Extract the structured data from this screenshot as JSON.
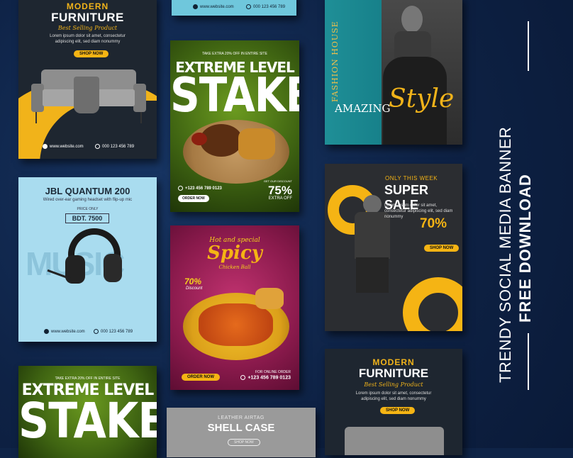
{
  "colors": {
    "accent": "#f5b414",
    "background": "#0f2447",
    "lime": "#4f7a16",
    "magenta": "#9c2158",
    "teal": "#178690"
  },
  "side_text": {
    "line1": "TRENDY SOCIAL MEDIA BANNER",
    "line2": "FREE DOWNLOAD"
  },
  "card_furniture": {
    "title_top": "MODERN",
    "title": "FURNITURE",
    "script": "Best Selling Product",
    "body": "Lorem ipsum dolor sit amet, consectetur adipiscing elit, sed diam nonummy",
    "button": "SHOP NOW",
    "website": "www.website.com",
    "phone": "000 123 456 789"
  },
  "card_strip": {
    "website": "www.website.com",
    "phone": "000 123 456 789"
  },
  "card_stake": {
    "tagline": "TAKE EXTRA 20% OFF IN ENTIRE SITE",
    "title_small": "EXTREME LEVEL",
    "title_big": "STAKE",
    "get_our": "GET OUR DISCOUNT",
    "discount": "75%",
    "extra": "EXTRA OFF",
    "phone": "+123 456 789 0123",
    "button": "ORDER NOW"
  },
  "card_fashion": {
    "vertical": "FASHION HOUSE",
    "word": "AMAZING",
    "script": "Style"
  },
  "card_jbl": {
    "title": "JBL QUANTUM 200",
    "subtitle": "Wired over-ear gaming headset with flip-up mic",
    "price_label": "PRICE ONLY",
    "price": "BDT. 7500",
    "bg_word": "MUSIC",
    "website": "www.website.com",
    "phone": "000 123 456 789"
  },
  "card_spicy": {
    "script_top": "Hot and special",
    "title": "Spicy",
    "script_sub": "Chicken Ball",
    "discount": "70%",
    "discount_sub": "Discount",
    "button": "ORDER NOW",
    "online": "FOR ONLINE ORDER",
    "phone": "+123 456 789 0123"
  },
  "card_sale": {
    "kicker": "ONLY THIS WEEK",
    "title": "SUPER SALE",
    "body": "Lorem ipsum dolor sit amet, consectetur adipiscing elit, sed diam nonummy",
    "discount": "70%",
    "button": "SHOP NOW"
  },
  "card_stake2": {
    "tagline": "TAKE EXTRA 20% OFF IN ENTIRE SITE",
    "title_small": "EXTREME LEVEL",
    "title_big": "STAKE"
  },
  "card_shell": {
    "kicker": "LEATHER AIRTAG",
    "title": "SHELL CASE",
    "button": "SHOP NOW"
  },
  "card_furniture2": {
    "title_top": "MODERN",
    "title": "FURNITURE",
    "script": "Best Selling Product",
    "body": "Lorem ipsum dolor sit amet, consectetur adipiscing elit, sed diam nonummy",
    "button": "SHOP NOW"
  }
}
